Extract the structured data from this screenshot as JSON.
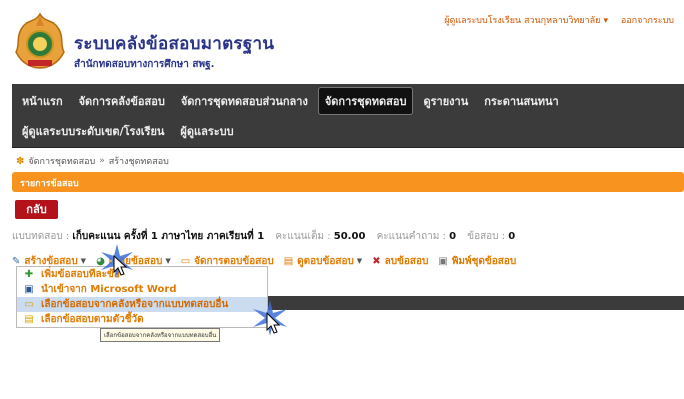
{
  "header": {
    "title": "ระบบคลังข้อสอบมาตรฐาน",
    "subtitle": "สำนักทดสอบทางการศึกษา สพฐ.",
    "user_label": "ผู้ดูแลระบบโรงเรียน สวนกุหลาบวิทยาลัย",
    "logout_label": "ออกจากระบบ"
  },
  "nav": {
    "row1": [
      "หน้าแรก",
      "จัดการคลังข้อสอบ",
      "จัดการชุดทดสอบส่วนกลาง",
      "จัดการชุดทดสอบ",
      "ดูรายงาน",
      "กระดานสนทนา"
    ],
    "row2": [
      "ผู้ดูแลระบบระดับเขต/โรงเรียน",
      "ผู้ดูแลระบบ"
    ],
    "active": "จัดการชุดทดสอบ"
  },
  "breadcrumb": {
    "item1": "จัดการชุดทดสอบ",
    "sep": "»",
    "item2": "สร้างชุดทดสอบ"
  },
  "panel": {
    "title": "รายการข้อสอบ"
  },
  "back_button": "กลับ",
  "info": {
    "test_label": "แบบทดสอบ :",
    "test_value": "เก็บคะแนน ครั้งที่ 1 ภาษาไทย ภาคเรียนที่ 1",
    "full_label": "คะแนนเต็ม :",
    "full_value": "50.00",
    "question_score_label": "คะแนนคำถาม :",
    "question_score_value": "0",
    "count_label": "ข้อสอบ :",
    "count_value": "0"
  },
  "toolbar": {
    "create": "สร้างข้อสอบ",
    "solve": "เฉลยข้อสอบ",
    "manage_answers": "จัดการตอบข้อสอบ",
    "view": "ดูตอบข้อสอบ",
    "delete": "ลบข้อสอบ",
    "print": "พิมพ์ชุดข้อสอบ"
  },
  "dropdown": {
    "items": [
      "เพิ่มข้อสอบทีละข้อ",
      "นำเข้าจาก Microsoft Word",
      "เลือกข้อสอบจากคลังหรือจากแบบทดสอบอื่น",
      "เลือกข้อสอบตามตัวชี้วัด"
    ]
  },
  "tooltip": "เลือกข้อสอบจากคลังหรือจากแบบทดสอบอื่น",
  "colors": {
    "accent": "#f7931e",
    "nav_bg": "#3b3b3b",
    "back_red": "#b3121b",
    "title_blue": "#2a3488"
  }
}
